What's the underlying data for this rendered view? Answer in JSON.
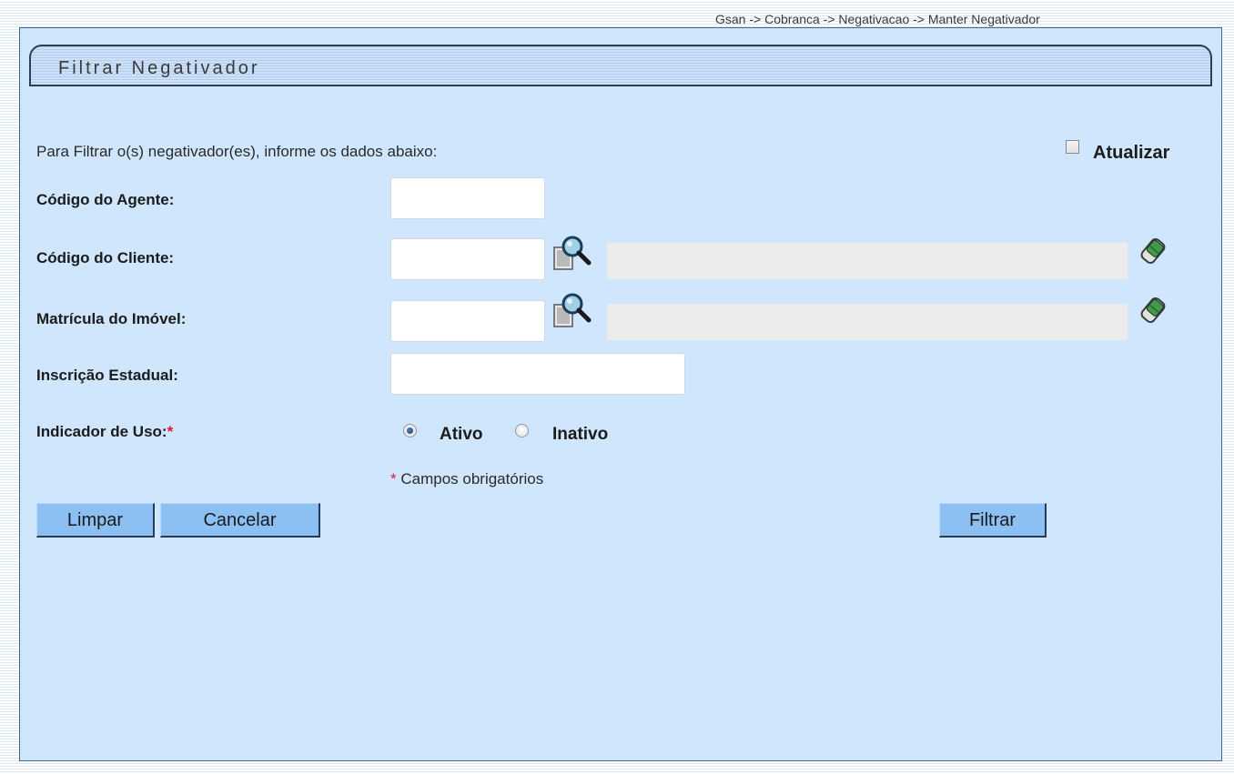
{
  "breadcrumb": "Gsan -> Cobranca -> Negativacao -> Manter Negativador",
  "panel": {
    "title": "Filtrar Negativador"
  },
  "form": {
    "intro": "Para Filtrar o(s) negativador(es), informe os dados abaixo:",
    "atualizar_label": "Atualizar",
    "atualizar_checked": false,
    "codigo_agente": {
      "label": "Código do Agente:",
      "value": ""
    },
    "codigo_cliente": {
      "label": "Código do Cliente:",
      "value": "",
      "description": ""
    },
    "matricula_imovel": {
      "label": "Matrícula do Imóvel:",
      "value": "",
      "description": ""
    },
    "inscricao_estadual": {
      "label": "Inscrição Estadual:",
      "value": ""
    },
    "indicador_uso": {
      "label": "Indicador de Uso:",
      "required_mark": "*",
      "options": [
        {
          "label": "Ativo",
          "selected": true
        },
        {
          "label": "Inativo",
          "selected": false
        }
      ]
    },
    "required_note_mark": "*",
    "required_note": "Campos obrigatórios"
  },
  "buttons": {
    "limpar": "Limpar",
    "cancelar": "Cancelar",
    "filtrar": "Filtrar"
  },
  "icons": {
    "search": "magnifier-search-icon",
    "clear": "eraser-icon"
  },
  "colors": {
    "panel_bg": "#cfe6fd",
    "button_bg": "#8cc0f2",
    "required": "#e3172a"
  }
}
